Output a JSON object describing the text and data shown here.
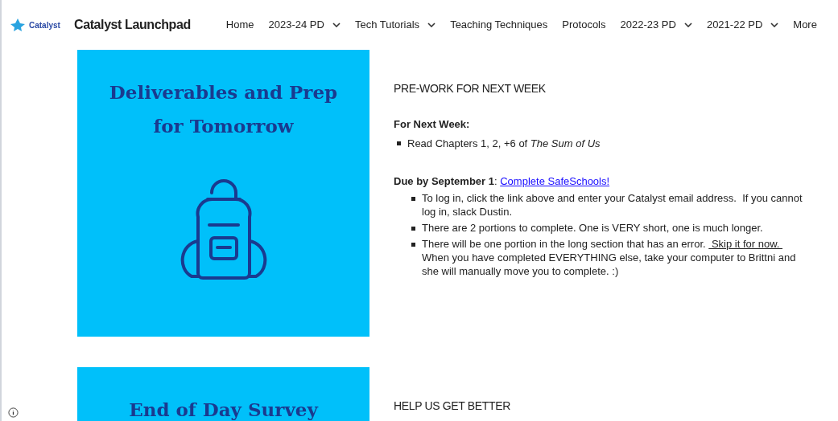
{
  "header": {
    "logo_text": "Catalyst",
    "site_title": "Catalyst Launchpad",
    "nav": [
      {
        "label": "Home",
        "dropdown": false
      },
      {
        "label": "2023-24 PD",
        "dropdown": true
      },
      {
        "label": "Tech Tutorials",
        "dropdown": true
      },
      {
        "label": "Teaching Techniques",
        "dropdown": false
      },
      {
        "label": "Protocols",
        "dropdown": false
      },
      {
        "label": "2022-23 PD",
        "dropdown": true
      },
      {
        "label": "2021-22 PD",
        "dropdown": true
      },
      {
        "label": "More",
        "dropdown": false
      }
    ]
  },
  "sections": [
    {
      "card_title": "Deliverables and Prep for Tomorrow",
      "heading": "PRE-WORK FOR NEXT WEEK",
      "subheading": "For Next Week:",
      "reading": [
        "Read Chapters 1, 2, +6 of *The Sum of Us*"
      ],
      "due": {
        "label": "**Due by September 1**: ",
        "link": "Complete SafeSchools!"
      },
      "bullets": [
        [
          {
            "text": "To log in, click the link above and enter your Catalyst email address.  If you cannot log in, slack Dustin.",
            "kind": "plain"
          }
        ],
        [
          {
            "text": "There are 2 portions to complete. One is VERY short, one is much longer.",
            "kind": "plain"
          }
        ],
        [
          {
            "text": "There will be one portion in the long section that has an error. ",
            "kind": "plain"
          },
          {
            "text": " Skip it for now. ",
            "kind": "underline"
          },
          {
            "text": "When you have completed EVERYTHING else, take your computer to Brittni and she will manually move you to complete. :)",
            "kind": "plain"
          }
        ]
      ]
    },
    {
      "card_title": "End of Day Survey",
      "heading": "HELP US GET BETTER"
    }
  ]
}
